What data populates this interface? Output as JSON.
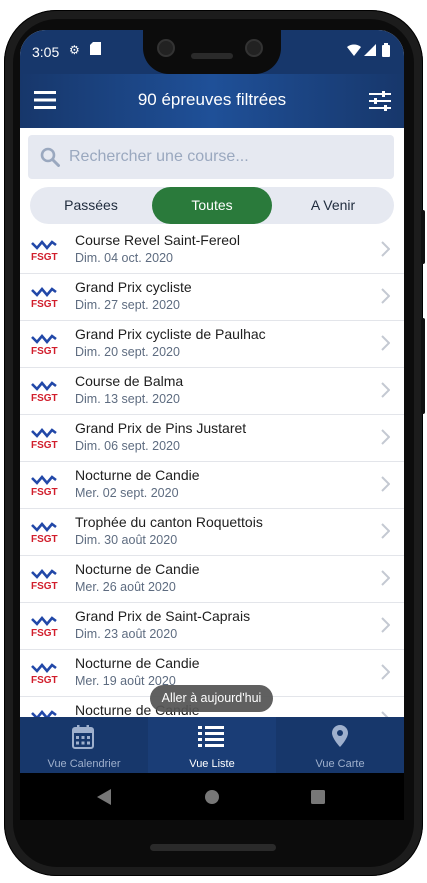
{
  "status_bar": {
    "time": "3:05"
  },
  "app_bar": {
    "title": "90 épreuves filtrées"
  },
  "search": {
    "placeholder": "Rechercher une course..."
  },
  "filter": {
    "options": [
      "Passées",
      "Toutes",
      "A Venir"
    ],
    "selected": "Toutes"
  },
  "races": [
    {
      "logo": "FSGT",
      "name": "Course Revel Saint-Fereol",
      "date": "Dim. 04 oct. 2020"
    },
    {
      "logo": "FSGT",
      "name": "Grand Prix cycliste",
      "date": "Dim. 27 sept. 2020"
    },
    {
      "logo": "FSGT",
      "name": "Grand Prix cycliste de Paulhac",
      "date": "Dim. 20 sept. 2020"
    },
    {
      "logo": "FSGT",
      "name": "Course de Balma",
      "date": "Dim. 13 sept. 2020"
    },
    {
      "logo": "FSGT",
      "name": "Grand Prix de Pins Justaret",
      "date": "Dim. 06 sept. 2020"
    },
    {
      "logo": "FSGT",
      "name": "Nocturne de Candie",
      "date": "Mer. 02 sept. 2020"
    },
    {
      "logo": "FSGT",
      "name": "Trophée du canton Roquettois",
      "date": "Dim. 30 août 2020"
    },
    {
      "logo": "FSGT",
      "name": "Nocturne de Candie",
      "date": "Mer. 26 août 2020"
    },
    {
      "logo": "FSGT",
      "name": "Grand Prix de Saint-Caprais",
      "date": "Dim. 23 août 2020"
    },
    {
      "logo": "FSGT",
      "name": "Nocturne de Candie",
      "date": "Mer. 19 août 2020"
    },
    {
      "logo": "FSGT",
      "name": "Nocturne de Candie",
      "date": ""
    }
  ],
  "toast": {
    "text": "Aller à aujourd'hui"
  },
  "bottom_nav": [
    {
      "label": "Vue Calendrier",
      "icon": "calendar-icon"
    },
    {
      "label": "Vue Liste",
      "icon": "list-icon",
      "active": true
    },
    {
      "label": "Vue Carte",
      "icon": "map-pin-icon"
    }
  ],
  "colors": {
    "primary": "#17376b",
    "accent": "#2a7a3b",
    "date_text": "#5e6c80"
  }
}
